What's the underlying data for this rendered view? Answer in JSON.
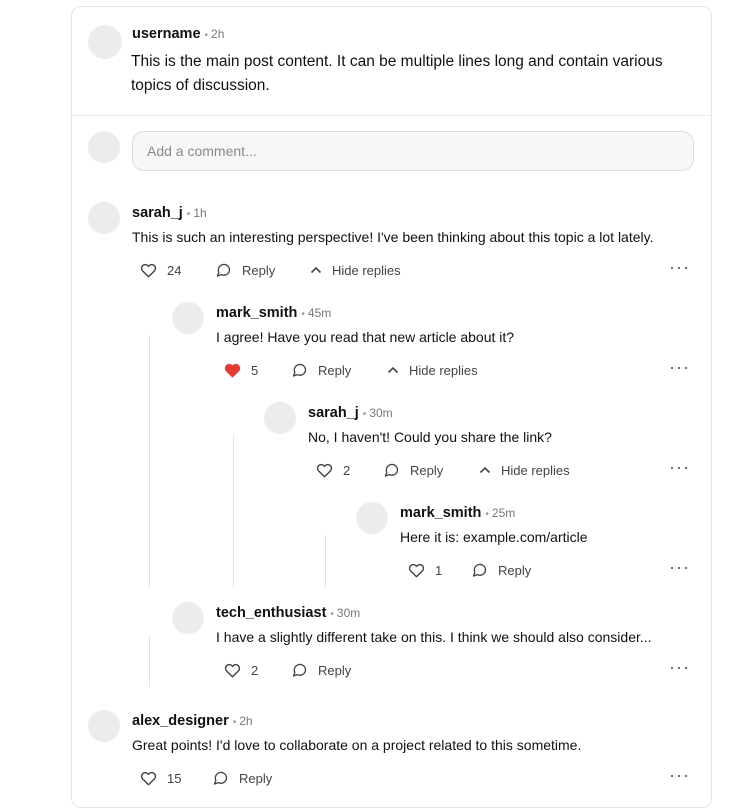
{
  "post": {
    "username": "username",
    "time": "2h",
    "content": "This is the main post content. It can be multiple lines long and contain various topics of discussion."
  },
  "comment_input": {
    "placeholder": "Add a comment..."
  },
  "labels": {
    "reply": "Reply",
    "hide_replies": "Hide replies"
  },
  "comments": [
    {
      "username": "sarah_j",
      "time": "1h",
      "text": "This is such an interesting perspective! I've been thinking about this topic a lot lately.",
      "likes": "24",
      "liked": false
    },
    {
      "username": "mark_smith",
      "time": "45m",
      "text": "I agree! Have you read that new article about it?",
      "likes": "5",
      "liked": true
    },
    {
      "username": "sarah_j",
      "time": "30m",
      "text": "No, I haven't! Could you share the link?",
      "likes": "2",
      "liked": false
    },
    {
      "username": "mark_smith",
      "time": "25m",
      "text": "Here it is: example.com/article",
      "likes": "1",
      "liked": false
    },
    {
      "username": "tech_enthusiast",
      "time": "30m",
      "text": "I have a slightly different take on this. I think we should also consider...",
      "likes": "2",
      "liked": false
    },
    {
      "username": "alex_designer",
      "time": "2h",
      "text": "Great points! I'd love to collaborate on a project related to this sometime.",
      "likes": "15",
      "liked": false
    }
  ],
  "colors": {
    "liked_heart": "#e53935"
  }
}
